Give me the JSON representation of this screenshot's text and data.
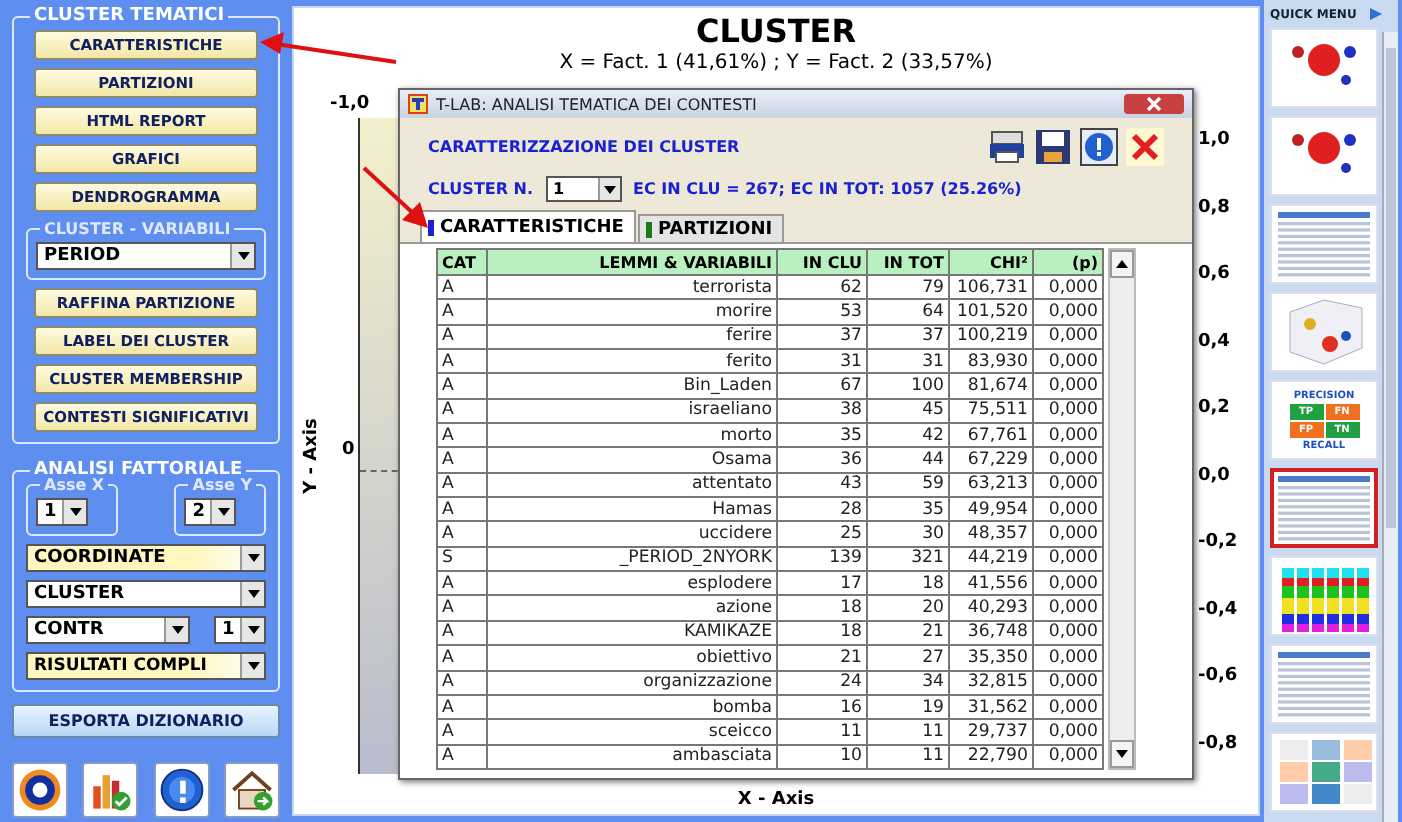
{
  "left_panel": {
    "cluster_group": {
      "title": "CLUSTER TEMATICI",
      "buttons": [
        "CARATTERISTICHE",
        "PARTIZIONI",
        "HTML REPORT",
        "GRAFICI",
        "DENDROGRAMMA"
      ],
      "variabili": {
        "title": "CLUSTER - VARIABILI",
        "value": "PERIOD"
      },
      "buttons_2": [
        "RAFFINA PARTIZIONE",
        "LABEL DEI CLUSTER",
        "CLUSTER MEMBERSHIP",
        "CONTESTI SIGNIFICATIVI"
      ]
    },
    "factor_group": {
      "title": "ANALISI FATTORIALE",
      "asse_x": {
        "label": "Asse X",
        "value": "1"
      },
      "asse_y": {
        "label": "Asse Y",
        "value": "2"
      },
      "dropdowns": [
        {
          "value": "COORDINATE",
          "highlighted": true
        },
        {
          "value": "CLUSTER",
          "highlighted": false
        }
      ],
      "contr": {
        "value": "CONTR",
        "number": "1"
      },
      "results": {
        "value": "RISULTATI COMPLI",
        "highlighted": true
      }
    },
    "export_button": "ESPORTA DIZIONARIO"
  },
  "chart": {
    "title": "CLUSTER",
    "subtitle": "X = Fact. 1 (41,61%) ; Y = Fact. 2 (33,57%)",
    "ylabel": "Y - Axis",
    "xlabel": "X - Axis",
    "left_ticks": [
      "-1,0",
      "0"
    ],
    "right_ticks": [
      "1,0",
      "0,8",
      "0,6",
      "0,4",
      "0,2",
      "0,0",
      "-0,2",
      "-0,4",
      "-0,6",
      "-0,8"
    ]
  },
  "dialog": {
    "title": "T-LAB: ANALISI TEMATICA DEI CONTESTI",
    "heading": "CARATTERIZZAZIONE DEI CLUSTER",
    "cluster_label": "CLUSTER N.",
    "cluster_value": "1",
    "info": "EC IN CLU = 267; EC IN TOT: 1057 (25.26%)",
    "tabs": [
      {
        "label": "CARATTERISTICHE",
        "selected": true
      },
      {
        "label": "PARTIZIONI",
        "selected": false
      }
    ],
    "table": {
      "columns": [
        "CAT",
        "LEMMI & VARIABILI",
        "IN CLU",
        "IN TOT",
        "CHI²",
        "(p)"
      ],
      "rows": [
        [
          "A",
          "terrorista",
          "62",
          "79",
          "106,731",
          "0,000"
        ],
        [
          "A",
          "morire",
          "53",
          "64",
          "101,520",
          "0,000"
        ],
        [
          "A",
          "ferire",
          "37",
          "37",
          "100,219",
          "0,000"
        ],
        [
          "A",
          "ferito",
          "31",
          "31",
          "83,930",
          "0,000"
        ],
        [
          "A",
          "Bin_Laden",
          "67",
          "100",
          "81,674",
          "0,000"
        ],
        [
          "A",
          "israeliano",
          "38",
          "45",
          "75,511",
          "0,000"
        ],
        [
          "A",
          "morto",
          "35",
          "42",
          "67,761",
          "0,000"
        ],
        [
          "A",
          "Osama",
          "36",
          "44",
          "67,229",
          "0,000"
        ],
        [
          "A",
          "attentato",
          "43",
          "59",
          "63,213",
          "0,000"
        ],
        [
          "A",
          "Hamas",
          "28",
          "35",
          "49,954",
          "0,000"
        ],
        [
          "A",
          "uccidere",
          "25",
          "30",
          "48,357",
          "0,000"
        ],
        [
          "S",
          "_PERIOD_2NYORK",
          "139",
          "321",
          "44,219",
          "0,000"
        ],
        [
          "A",
          "esplodere",
          "17",
          "18",
          "41,556",
          "0,000"
        ],
        [
          "A",
          "azione",
          "18",
          "20",
          "40,293",
          "0,000"
        ],
        [
          "A",
          "KAMIKAZE",
          "18",
          "21",
          "36,748",
          "0,000"
        ],
        [
          "A",
          "obiettivo",
          "21",
          "27",
          "35,350",
          "0,000"
        ],
        [
          "A",
          "organizzazione",
          "24",
          "34",
          "32,815",
          "0,000"
        ],
        [
          "A",
          "bomba",
          "16",
          "19",
          "31,562",
          "0,000"
        ],
        [
          "A",
          "sceicco",
          "11",
          "11",
          "29,737",
          "0,000"
        ],
        [
          "A",
          "ambasciata",
          "10",
          "11",
          "22,790",
          "0,000"
        ]
      ]
    }
  },
  "quick_menu": {
    "title": "QUICK MENU",
    "thumbnails": [
      {
        "kind": "bubbles",
        "selected": false
      },
      {
        "kind": "bubbles",
        "selected": false
      },
      {
        "kind": "table",
        "selected": false
      },
      {
        "kind": "cube",
        "selected": false
      },
      {
        "kind": "precision",
        "selected": false,
        "texts": [
          "PRECISION",
          "TP",
          "FN",
          "FP",
          "TN",
          "RECALL"
        ]
      },
      {
        "kind": "table",
        "selected": true
      },
      {
        "kind": "bars",
        "selected": false
      },
      {
        "kind": "table",
        "selected": false
      },
      {
        "kind": "grid",
        "selected": false
      }
    ]
  }
}
